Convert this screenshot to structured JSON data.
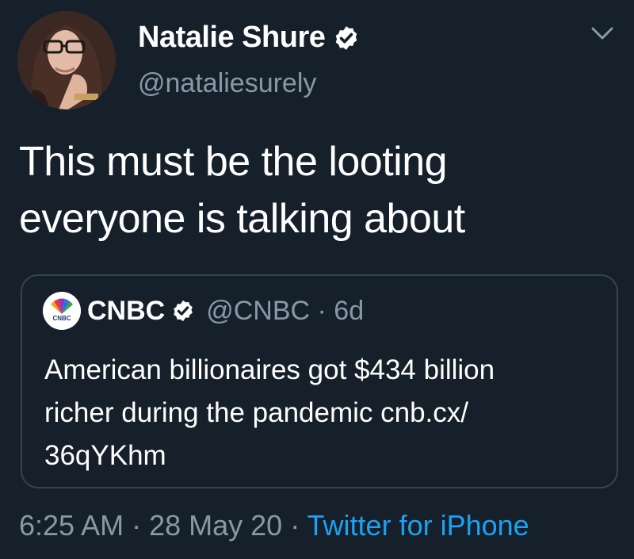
{
  "author": {
    "display_name": "Natalie Shure",
    "handle": "@nataliesurely",
    "verified_icon": "verified-check-icon"
  },
  "tweet": {
    "text_line1": "This must be the looting",
    "text_line2": "everyone is talking about"
  },
  "quote": {
    "display_name": "CNBC",
    "handle_time": "@CNBC · 6d",
    "text_line1": "American billionaires got $434 billion",
    "text_line2": "richer during the pandemic cnb.cx/",
    "text_line3": "36qYKhm"
  },
  "meta": {
    "time": "6:25 AM",
    "sep1": " · ",
    "date": "28 May 20",
    "sep2": " · ",
    "source": "Twitter for iPhone"
  },
  "colors": {
    "background": "#15202b",
    "secondary_text": "#8899a6",
    "link": "#1da1f2",
    "border": "#38444d"
  }
}
